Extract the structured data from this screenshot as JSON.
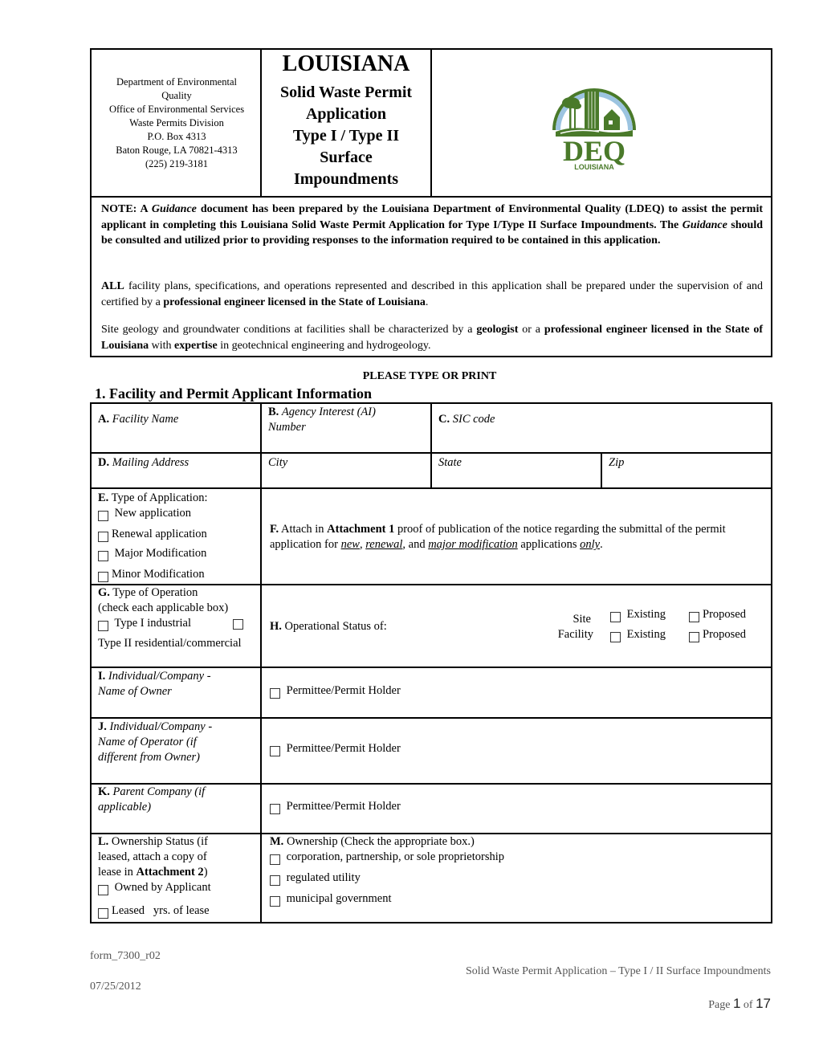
{
  "header": {
    "agency_lines": [
      "Department of Environmental",
      "Quality",
      "Office of Environmental Services",
      "Waste Permits Division",
      "P.O. Box 4313",
      "Baton Rouge, LA  70821-4313",
      "(225) 219-3181"
    ],
    "state_title": "LOUISIANA",
    "form_title_lines": [
      "Solid Waste Permit",
      "Application",
      "Type I / Type II",
      "Surface",
      "Impoundments"
    ],
    "logo": {
      "name": "deq-louisiana-logo",
      "text_main": "DEQ",
      "text_sub": "LOUISIANA",
      "green": "#4a7a2a",
      "sky": "#9cc4e0"
    }
  },
  "notes": {
    "note1": {
      "prefix": "NOTE: A ",
      "guidance1": "Guidance",
      "mid1": " document has been prepared by the Louisiana Department of Environmental Quality (LDEQ) to assist the permit applicant in completing this Louisiana Solid Waste Permit Application for Type I/Type II Surface Impoundments.  The ",
      "guidance2": "Guidance",
      "tail": " should be consulted and utilized prior to providing responses to the information required to be contained in this application."
    },
    "note2": {
      "all": "ALL",
      "mid": " facility plans, specifications, and operations represented and described in this application shall be prepared under the supervision of and certified by a ",
      "bold": "professional engineer licensed in the State of Louisiana",
      "tail": "."
    },
    "note3": {
      "t1": "Site geology and groundwater conditions at facilities shall be characterized by a ",
      "b1": "geologist",
      "t2": " or a ",
      "b2": "professional engineer licensed in the State of Louisiana",
      "t3": " with ",
      "b3": "expertise",
      "t4": " in geotechnical engineering and hydrogeology."
    }
  },
  "please_type": "PLEASE TYPE OR PRINT",
  "section": {
    "title": "1.  Facility and Permit Applicant Information",
    "A": {
      "letter": "A.",
      "label": "Facility Name"
    },
    "B": {
      "letter": "B.",
      "label_line1": "Agency Interest (AI)",
      "label_line2": "Number"
    },
    "C": {
      "letter": "C.",
      "label": "SIC code"
    },
    "D": {
      "letter": "D.",
      "label": "Mailing Address",
      "city": "City",
      "state": "State",
      "zip": "Zip"
    },
    "E": {
      "letter": "E.",
      "label": "Type of Application:",
      "options": [
        "New application",
        "Renewal application",
        "Major Modification",
        "Minor Modification"
      ]
    },
    "F": {
      "letter": "F.",
      "t1": " Attach in ",
      "attachment": "Attachment 1",
      "t2": " proof of publication of the notice regarding the submittal of the permit application for ",
      "new": "new",
      "comma1": ", ",
      "renewal": "renewal",
      "t3": ", and ",
      "major": "major modification",
      "t4": " applications ",
      "only": "only",
      "t5": "."
    },
    "G": {
      "letter": "G.",
      "label": "Type of Operation",
      "hint": "(check each applicable box)",
      "options": [
        "Type I industrial",
        "Type II residential/commercial"
      ]
    },
    "H": {
      "letter": "H.",
      "label": "Operational Status of:",
      "rows": [
        {
          "label": "Site",
          "existing": "Existing",
          "proposed": "Proposed"
        },
        {
          "label": "Facility",
          "existing": "Existing",
          "proposed": "Proposed"
        }
      ]
    },
    "I": {
      "letter": "I.",
      "label_line1": "Individual/Company -",
      "label_line2": "Name of Owner",
      "checkbox": "Permittee/Permit Holder"
    },
    "J": {
      "letter": "J.",
      "label_line1": "Individual/Company -",
      "label_line2": "Name of Operator (if",
      "label_line3": "different from Owner)",
      "checkbox": "Permittee/Permit Holder"
    },
    "K": {
      "letter": "K.",
      "label_line1": "Parent Company (if",
      "label_line2": "applicable)",
      "checkbox": "Permittee/Permit Holder"
    },
    "L": {
      "letter": "L.",
      "line1": "Ownership Status (if",
      "line2": "leased, attach a copy of",
      "line3a": "lease in ",
      "line3b": "Attachment 2",
      "line3c": ")",
      "options": [
        "Owned by Applicant",
        "Leased   yrs. of lease"
      ]
    },
    "M": {
      "letter": "M.",
      "label": "Ownership (Check the appropriate box.)",
      "options": [
        "corporation, partnership, or sole proprietorship",
        "regulated utility",
        "municipal government"
      ]
    }
  },
  "footer": {
    "form_id": "form_7300_r02",
    "date": "07/25/2012",
    "doc_title": "Solid Waste Permit Application – Type I / II Surface Impoundments",
    "page_word": "Page ",
    "page_num": "1",
    "of_word": " of ",
    "page_total": "17"
  }
}
